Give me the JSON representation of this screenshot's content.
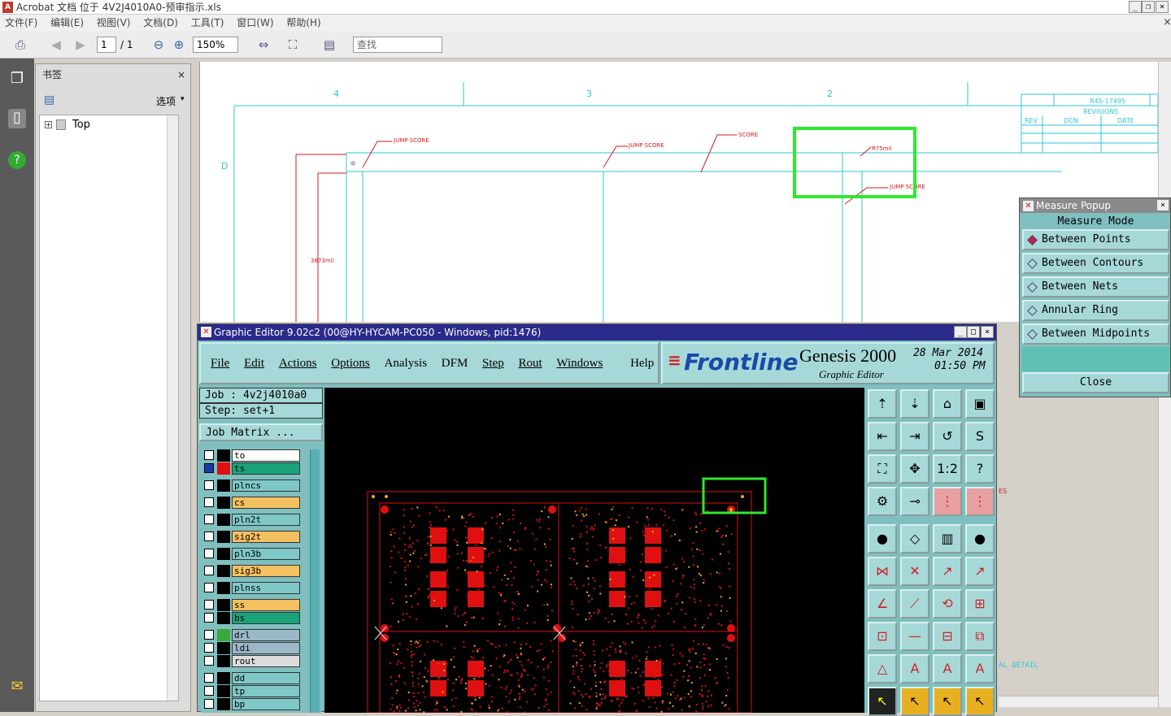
{
  "window": {
    "title": "Acrobat 文档 位于 4V2J4010A0-预审指示.xls"
  },
  "menu": [
    "文件(F)",
    "编辑(E)",
    "视图(V)",
    "文档(D)",
    "工具(T)",
    "窗口(W)",
    "帮助(H)"
  ],
  "toolbar": {
    "page_current": "1",
    "page_total": "/ 1",
    "zoom": "150%",
    "search_placeholder": "查找"
  },
  "bookmarks": {
    "title": "书签",
    "options_label": "选项",
    "items": [
      {
        "label": "Top"
      }
    ]
  },
  "drawing": {
    "col_labels": [
      "4",
      "3",
      "2"
    ],
    "row_label": "D",
    "annotations": [
      "JUMP SCORE",
      "JUMP SCORE",
      "SCORE",
      "R75mil",
      "JUMP SCORE",
      "3873mil"
    ],
    "revision_block": {
      "part": "R45-17495",
      "title": "REVISIONS",
      "headers": [
        "REV",
        "DCN",
        "DATE"
      ]
    },
    "side_text": [
      "ES",
      "AL DETAIL"
    ]
  },
  "graphic_editor": {
    "title": "Graphic Editor 9.02c2 (00@HY-HYCAM-PC050 - Windows, pid:1476)",
    "menu": [
      "File",
      "Edit",
      "Actions",
      "Options",
      "Analysis",
      "DFM",
      "Step",
      "Rout",
      "Windows",
      "Help"
    ],
    "brand": "Frontline",
    "product": "Genesis 2000",
    "subtitle": "Graphic Editor",
    "date": "28 Mar 2014",
    "time": "01:50 PM",
    "job": "Job : 4v2j4010a0",
    "step": "Step: set+1",
    "job_matrix": "Job Matrix ...",
    "layers": [
      {
        "name": "to",
        "color": "#ffffff"
      },
      {
        "name": "ts",
        "color": "#1aa37a"
      },
      {
        "name": "plncs",
        "color": "#7fc8c8"
      },
      {
        "name": "cs",
        "color": "#f5c060"
      },
      {
        "name": "pln2t",
        "color": "#7fc8c8"
      },
      {
        "name": "sig2t",
        "color": "#f5c060"
      },
      {
        "name": "pln3b",
        "color": "#7fc8c8"
      },
      {
        "name": "sig3b",
        "color": "#f5c060"
      },
      {
        "name": "plnss",
        "color": "#7fc8c8"
      },
      {
        "name": "ss",
        "color": "#f5c060"
      },
      {
        "name": "bs",
        "color": "#1aa37a"
      },
      {
        "name": "drl",
        "color": "#9ab8c8"
      },
      {
        "name": "ldi",
        "color": "#9ab8c8"
      },
      {
        "name": "rout",
        "color": "#dcdcdc"
      },
      {
        "name": "dd",
        "color": "#7fc8c8"
      },
      {
        "name": "tp",
        "color": "#7fc8c8"
      },
      {
        "name": "bp",
        "color": "#7fc8c8"
      }
    ]
  },
  "measure_popup": {
    "title": "Measure Popup",
    "mode_label": "Measure Mode",
    "options": [
      {
        "label": "Between Points",
        "selected": true
      },
      {
        "label": "Between Contours",
        "selected": false
      },
      {
        "label": "Between Nets",
        "selected": false
      },
      {
        "label": "Annular Ring",
        "selected": false
      },
      {
        "label": "Between Midpoints",
        "selected": false
      }
    ],
    "close_label": "Close"
  }
}
